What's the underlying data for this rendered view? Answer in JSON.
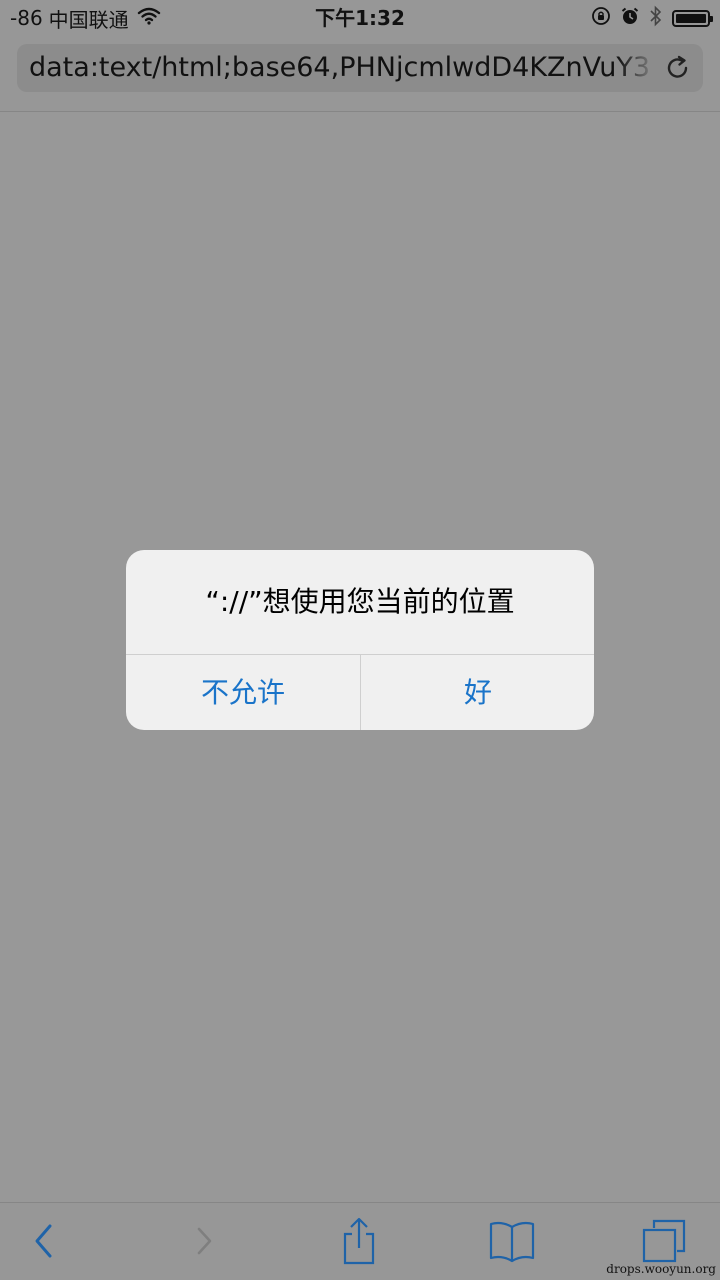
{
  "status_bar": {
    "signal": "-86",
    "carrier": "中国联通",
    "time": "下午1:32",
    "icons": [
      "wifi-icon",
      "orientation-lock-icon",
      "alarm-icon",
      "bluetooth-icon",
      "battery-icon"
    ],
    "battery_level": 1.0
  },
  "address_bar": {
    "url": "data:text/html;base64,PHNjcmlwdD4KZnVuY3"
  },
  "alert": {
    "title": "“://”想使用您当前的位置",
    "deny_label": "不允许",
    "ok_label": "好"
  },
  "toolbar": {
    "icons": [
      "back-icon",
      "forward-icon",
      "share-icon",
      "bookmarks-icon",
      "tabs-icon"
    ]
  },
  "watermark": "drops.wooyun.org",
  "colors": {
    "overlay": "#989898",
    "alert_bg": "#f0f0f0",
    "accent": "#1a74c9"
  }
}
